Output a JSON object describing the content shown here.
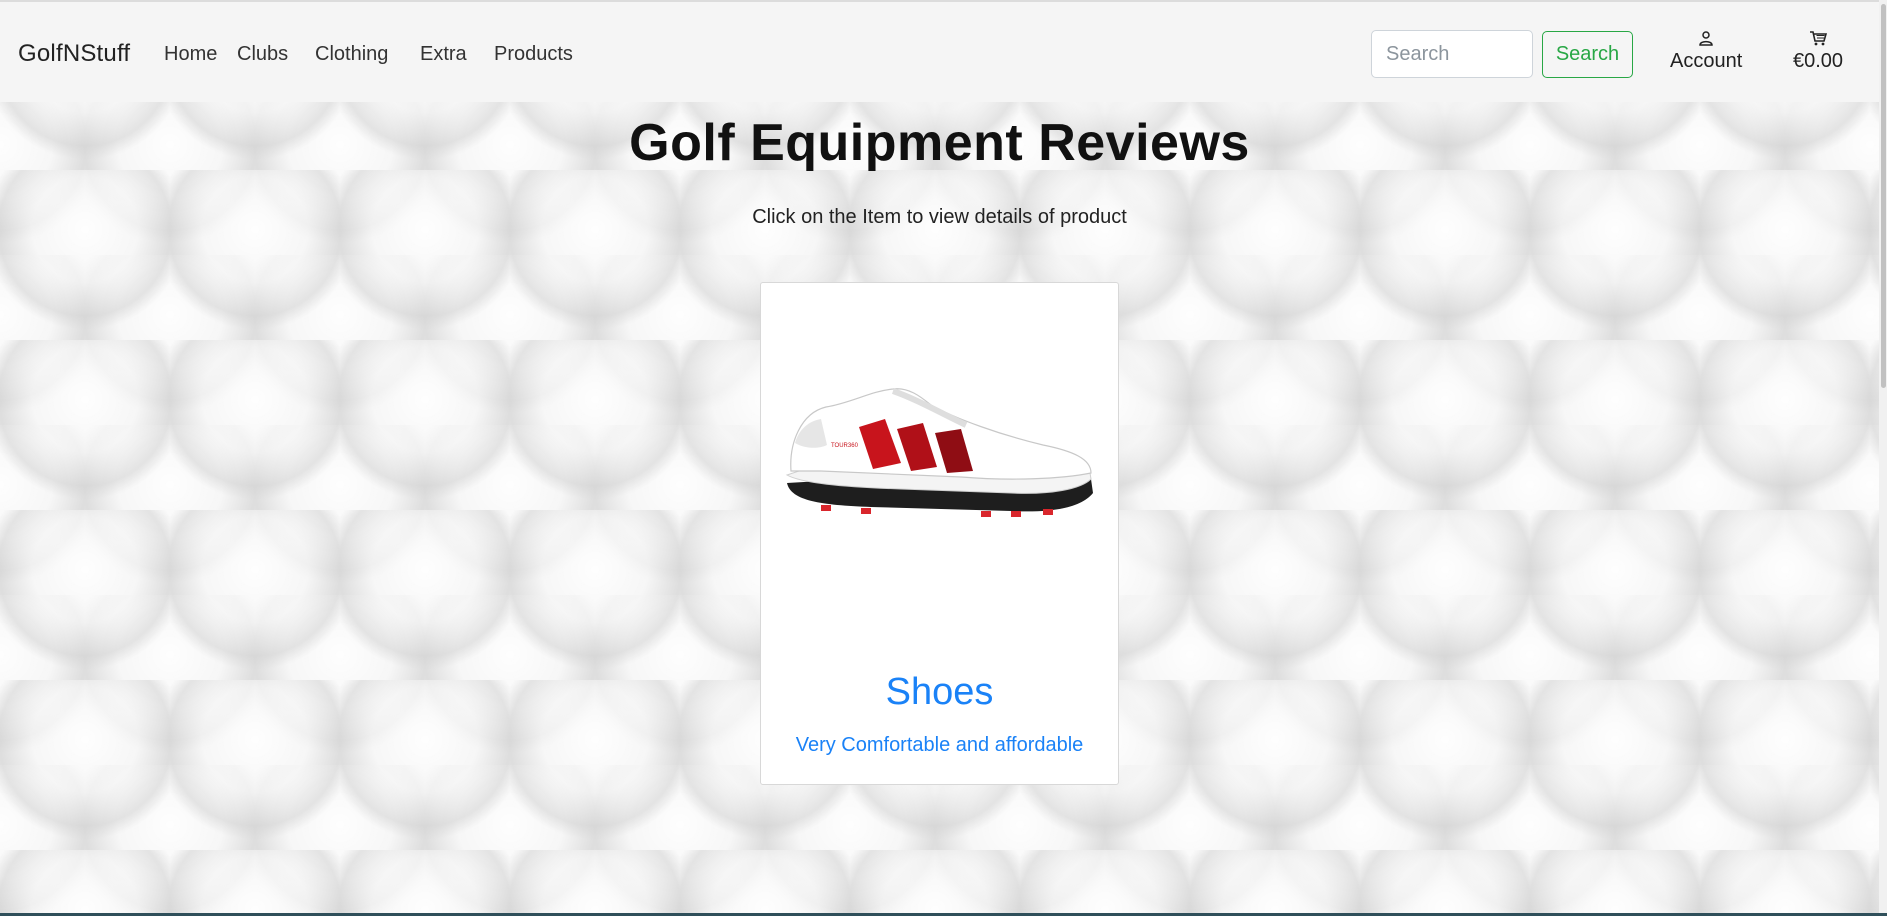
{
  "navbar": {
    "brand": "GolfNStuff",
    "links": [
      {
        "label": "Home"
      },
      {
        "label": "Clubs"
      },
      {
        "label": "Clothing"
      },
      {
        "label": "Extra"
      },
      {
        "label": "Products"
      }
    ],
    "search": {
      "placeholder": "Search",
      "button_label": "Search"
    },
    "account_label": "Account",
    "cart_total": "€0.00",
    "icons": {
      "account": "user-icon",
      "cart": "cart-icon"
    }
  },
  "main": {
    "title": "Golf Equipment Reviews",
    "subtitle": "Click on the Item to view details of product",
    "products": [
      {
        "title": "Shoes",
        "description": "Very Comfortable and affordable",
        "image": "golf-shoe-image"
      }
    ]
  },
  "colors": {
    "link_blue": "#1a82f7",
    "search_green": "#28a745",
    "navbar_bg": "#f5f5f5"
  }
}
